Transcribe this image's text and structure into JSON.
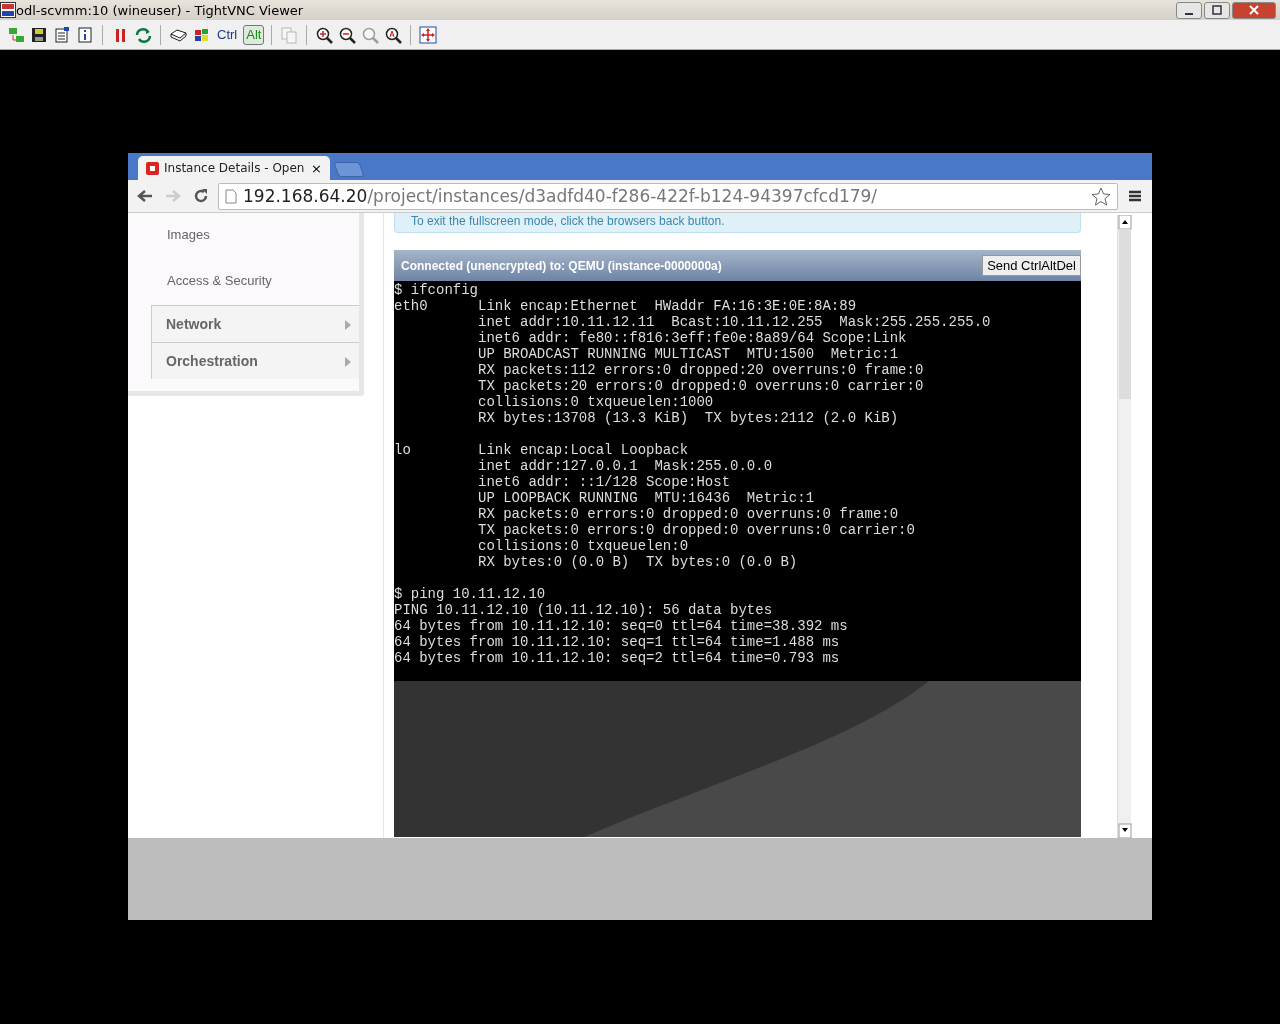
{
  "window": {
    "title": "odl-scvmm:10 (wineuser) - TightVNC Viewer"
  },
  "toolbar": [
    {
      "kind": "icon",
      "disabled": false
    },
    {
      "kind": "icon",
      "disabled": false
    },
    {
      "kind": "icon",
      "disabled": false
    },
    {
      "kind": "icon",
      "disabled": false
    },
    {
      "kind": "sep"
    },
    {
      "kind": "icon",
      "disabled": false
    },
    {
      "kind": "icon",
      "disabled": false
    },
    {
      "kind": "sep"
    },
    {
      "kind": "icon",
      "disabled": false
    },
    {
      "kind": "icon",
      "disabled": false
    },
    {
      "kind": "text",
      "label": "Ctrl",
      "selected": false
    },
    {
      "kind": "text",
      "label": "Alt",
      "selected": true
    },
    {
      "kind": "sep"
    },
    {
      "kind": "icon",
      "disabled": true
    },
    {
      "kind": "sep"
    },
    {
      "kind": "icon",
      "disabled": false
    },
    {
      "kind": "icon",
      "disabled": false
    },
    {
      "kind": "icon",
      "disabled": true
    },
    {
      "kind": "icon",
      "disabled": false
    },
    {
      "kind": "sep"
    },
    {
      "kind": "icon",
      "disabled": false
    }
  ],
  "browser": {
    "tab": {
      "title": "Instance Details - Open",
      "close": "×"
    },
    "url_host": "192.168.64.20",
    "url_path": "/project/instances/d3adfd40-f286-422f-b124-94397cfcd179/"
  },
  "sidebar": {
    "items": [
      {
        "label": "Images",
        "kind": "link"
      },
      {
        "label": "Access & Security",
        "kind": "link"
      },
      {
        "label": "Network",
        "kind": "section",
        "expanded": false
      },
      {
        "label": "Orchestration",
        "kind": "section",
        "expanded": false
      }
    ]
  },
  "notice": "To exit the fullscreen mode, click the browsers back button.",
  "console": {
    "status": "Connected (unencrypted) to: QEMU (instance-0000000a)",
    "button": "Send CtrlAltDel",
    "blocks": [
      [
        "$ ifconfig",
        "eth0      Link encap:Ethernet  HWaddr FA:16:3E:0E:8A:89",
        "          inet addr:10.11.12.11  Bcast:10.11.12.255  Mask:255.255.255.0",
        "          inet6 addr: fe80::f816:3eff:fe0e:8a89/64 Scope:Link",
        "          UP BROADCAST RUNNING MULTICAST  MTU:1500  Metric:1",
        "          RX packets:112 errors:0 dropped:20 overruns:0 frame:0",
        "          TX packets:20 errors:0 dropped:0 overruns:0 carrier:0",
        "          collisions:0 txqueuelen:1000",
        "          RX bytes:13708 (13.3 KiB)  TX bytes:2112 (2.0 KiB)"
      ],
      [
        "lo        Link encap:Local Loopback",
        "          inet addr:127.0.0.1  Mask:255.0.0.0",
        "          inet6 addr: ::1/128 Scope:Host",
        "          UP LOOPBACK RUNNING  MTU:16436  Metric:1",
        "          RX packets:0 errors:0 dropped:0 overruns:0 frame:0",
        "          TX packets:0 errors:0 dropped:0 overruns:0 carrier:0",
        "          collisions:0 txqueuelen:0",
        "          RX bytes:0 (0.0 B)  TX bytes:0 (0.0 B)"
      ],
      [
        "$ ping 10.11.12.10",
        "PING 10.11.12.10 (10.11.12.10): 56 data bytes",
        "64 bytes from 10.11.12.10: seq=0 ttl=64 time=38.392 ms",
        "64 bytes from 10.11.12.10: seq=1 ttl=64 time=1.488 ms",
        "64 bytes from 10.11.12.10: seq=2 ttl=64 time=0.793 ms"
      ]
    ]
  }
}
